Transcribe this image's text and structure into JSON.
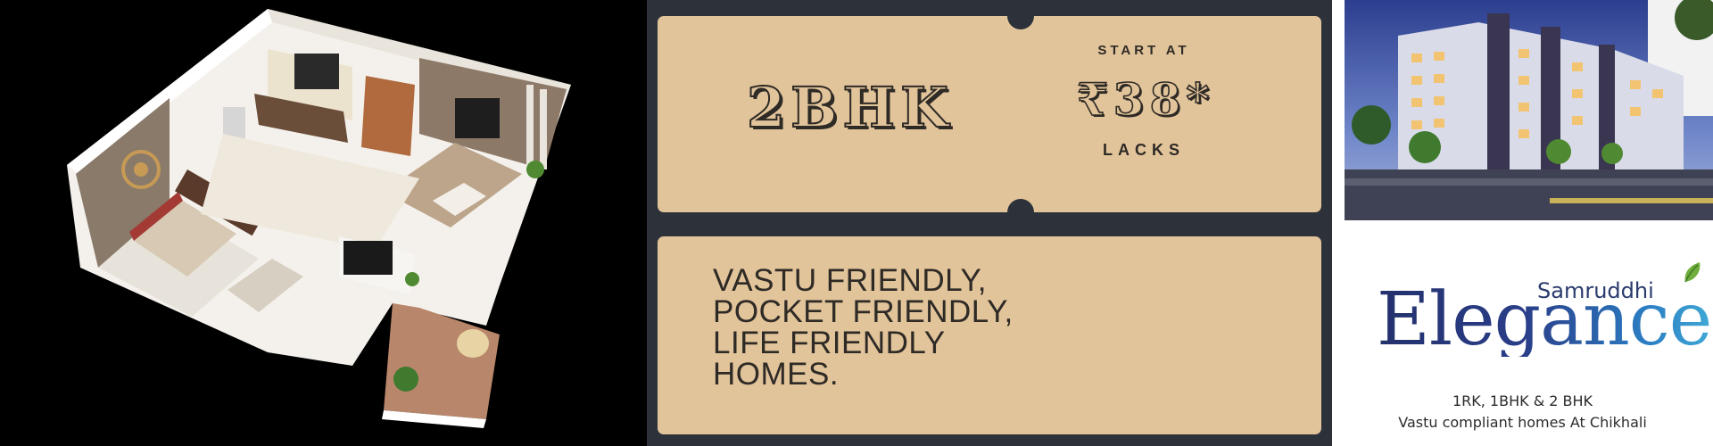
{
  "ticket": {
    "title": "2BHK",
    "start_label": "START AT",
    "price": "₹38*",
    "unit": "LACKS"
  },
  "slogan": {
    "lines": [
      "VASTU FRIENDLY,",
      "POCKET FRIENDLY,",
      "LIFE FRIENDLY",
      "HOMES."
    ]
  },
  "brand": {
    "name_small": "Samruddhi",
    "name_big": "Elegance",
    "tagline_line1": "1RK, 1BHK & 2 BHK",
    "tagline_line2": "Vastu compliant homes At Chikhali"
  },
  "colors": {
    "ticket_bg": "#e2c49b",
    "panel_bg": "#2d323a",
    "brand_navy": "#23306b",
    "brand_blue": "#3fa8d6"
  },
  "images": {
    "floor_plan": "3d-floor-plan-illustration",
    "building": "apartment-building-photo"
  }
}
